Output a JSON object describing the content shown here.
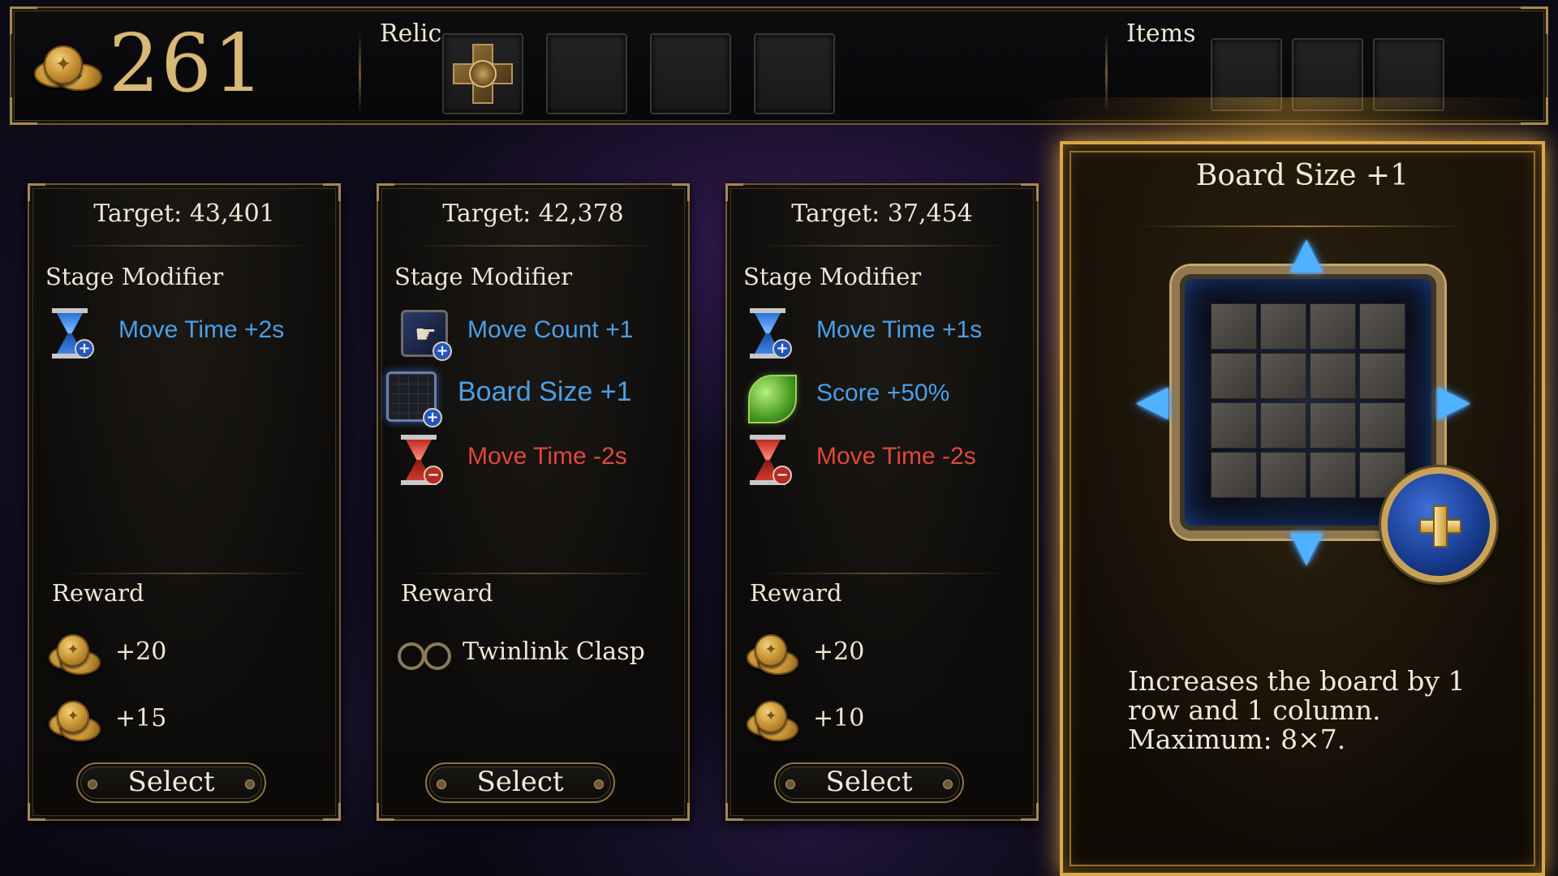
{
  "hud": {
    "gold_count": "261",
    "relic_label": "Relic",
    "items_label": "Items"
  },
  "stages": [
    {
      "target": "Target: 43,401",
      "modifier_title": "Stage Modifier",
      "modifiers": [
        {
          "text": "Move Time +2s",
          "type": "buff",
          "icon": "hourglass-plus-icon"
        }
      ],
      "reward_title": "Reward",
      "rewards": [
        {
          "text": "+20",
          "icon": "gold-coins-icon"
        },
        {
          "text": "+15",
          "icon": "gold-coins-icon"
        }
      ],
      "select_label": "Select"
    },
    {
      "target": "Target: 42,378",
      "modifier_title": "Stage Modifier",
      "modifiers": [
        {
          "text": "Move Count +1",
          "type": "buff",
          "icon": "move-count-plus-icon"
        },
        {
          "text": "Board Size +1",
          "type": "buff",
          "icon": "board-size-plus-icon"
        },
        {
          "text": "Move Time -2s",
          "type": "debuff",
          "icon": "hourglass-minus-icon"
        }
      ],
      "reward_title": "Reward",
      "rewards": [
        {
          "text": "Twinlink Clasp",
          "icon": "twinlink-clasp-icon"
        }
      ],
      "select_label": "Select"
    },
    {
      "target": "Target: 37,454",
      "modifier_title": "Stage Modifier",
      "modifiers": [
        {
          "text": "Move Time +1s",
          "type": "buff",
          "icon": "hourglass-plus-icon"
        },
        {
          "text": "Score +50%",
          "type": "buff",
          "icon": "leaf-icon"
        },
        {
          "text": "Move Time -2s",
          "type": "debuff",
          "icon": "hourglass-minus-icon"
        }
      ],
      "reward_title": "Reward",
      "rewards": [
        {
          "text": "+20",
          "icon": "gold-coins-icon"
        },
        {
          "text": "+10",
          "icon": "gold-coins-icon"
        }
      ],
      "select_label": "Select"
    }
  ],
  "detail": {
    "title": "Board Size +1",
    "description_lines": [
      "Increases the board by 1",
      "row and 1 column.",
      "Maximum: 8×7."
    ]
  },
  "colors": {
    "buff": "#4a9fe8",
    "debuff": "#e2473a",
    "gold": "#d8b877",
    "frame": "#6e5a36",
    "highlight": "#d8a84a"
  }
}
